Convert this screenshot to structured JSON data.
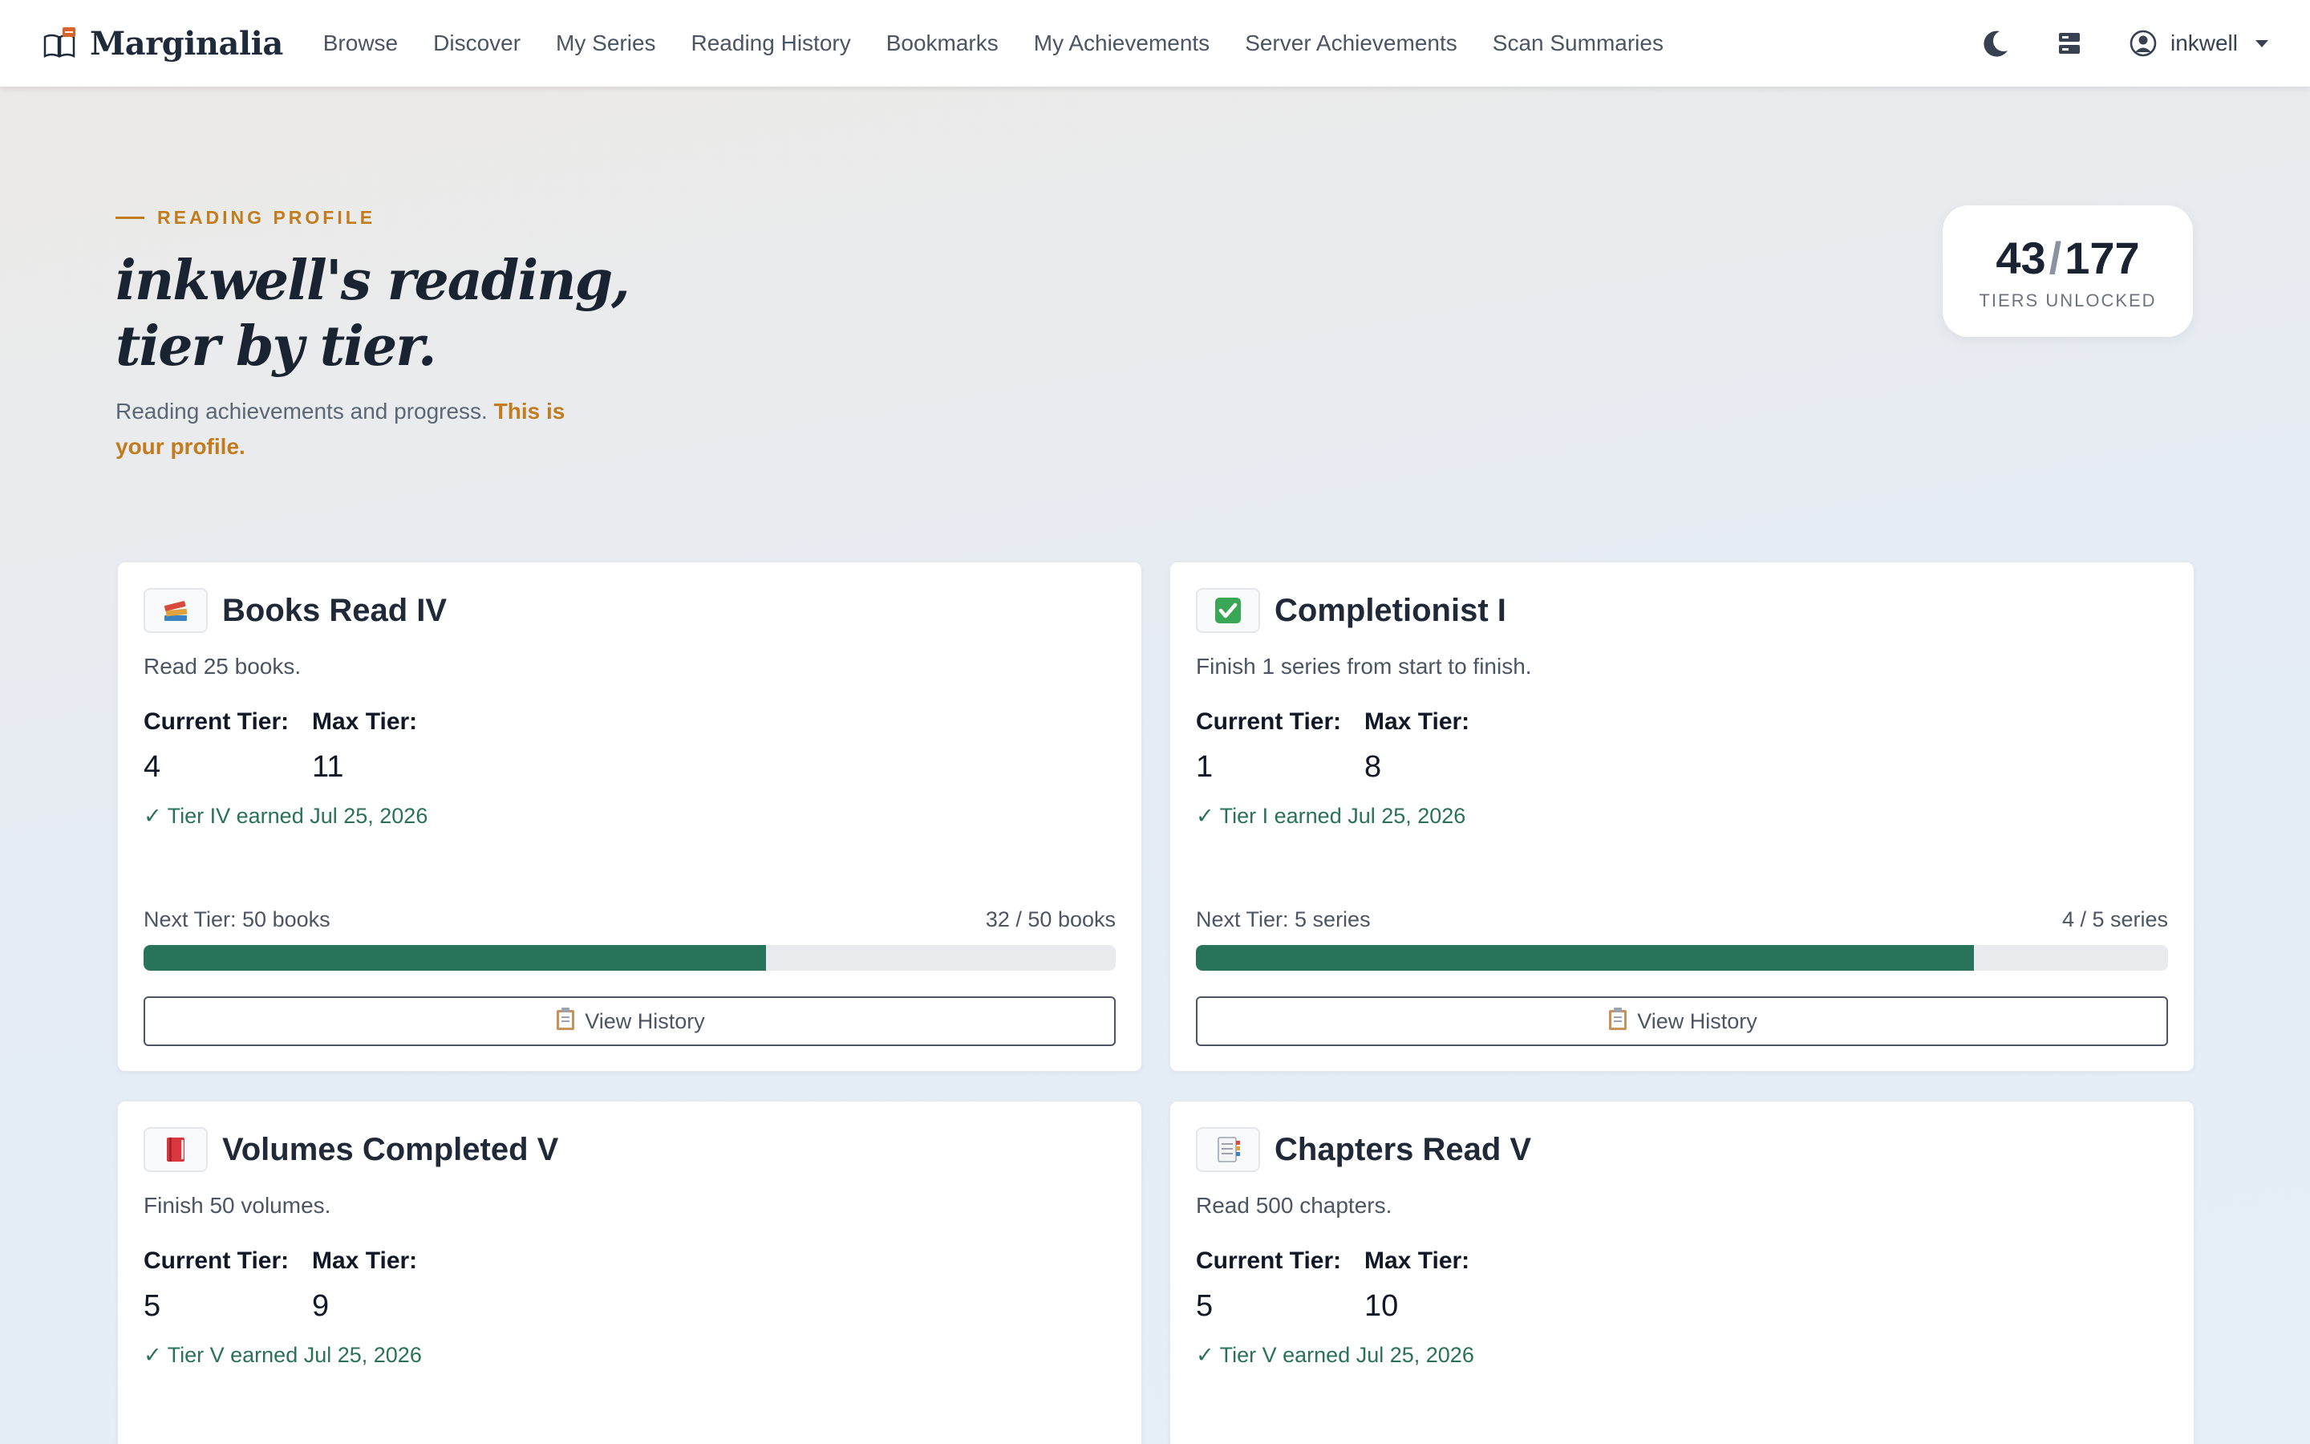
{
  "navbar": {
    "brand": "Marginalia",
    "links": [
      "Browse",
      "Discover",
      "My Series",
      "Reading History",
      "Bookmarks",
      "My Achievements",
      "Server Achievements",
      "Scan Summaries"
    ],
    "user": "inkwell"
  },
  "hero": {
    "eyebrow": "READING PROFILE",
    "title_line1": "inkwell's reading,",
    "title_line2": "tier by tier.",
    "subtitle": "Reading achievements and progress.",
    "subtitle_accent": "This is your profile."
  },
  "tier_summary": {
    "unlocked": "43",
    "slash": "/",
    "total": "177",
    "label": "TIERS UNLOCKED"
  },
  "labels": {
    "current_tier": "Current Tier:",
    "max_tier": "Max Tier:",
    "view_history": "View History"
  },
  "cards": [
    {
      "icon": "books-icon",
      "title": "Books Read IV",
      "description": "Read 25 books.",
      "current_tier": "4",
      "max_tier": "11",
      "earned": "✓ Tier IV earned Jul 25, 2026",
      "next_tier": "Next Tier: 50 books",
      "progress_text": "32 / 50 books",
      "progress_fraction": 0.64
    },
    {
      "icon": "check-box-icon",
      "title": "Completionist I",
      "description": "Finish 1 series from start to finish.",
      "current_tier": "1",
      "max_tier": "8",
      "earned": "✓ Tier I earned Jul 25, 2026",
      "next_tier": "Next Tier: 5 series",
      "progress_text": "4 / 5 series",
      "progress_fraction": 0.8
    },
    {
      "icon": "red-book-icon",
      "title": "Volumes Completed V",
      "description": "Finish 50 volumes.",
      "current_tier": "5",
      "max_tier": "9",
      "earned": "✓ Tier V earned Jul 25, 2026"
    },
    {
      "icon": "bookmark-tabs-icon",
      "title": "Chapters Read V",
      "description": "Read 500 chapters.",
      "current_tier": "5",
      "max_tier": "10",
      "earned": "✓ Tier V earned Jul 25, 2026"
    }
  ],
  "colors": {
    "accent": "#c27c1e",
    "progress": "#28745a",
    "earned": "#2a7257"
  }
}
